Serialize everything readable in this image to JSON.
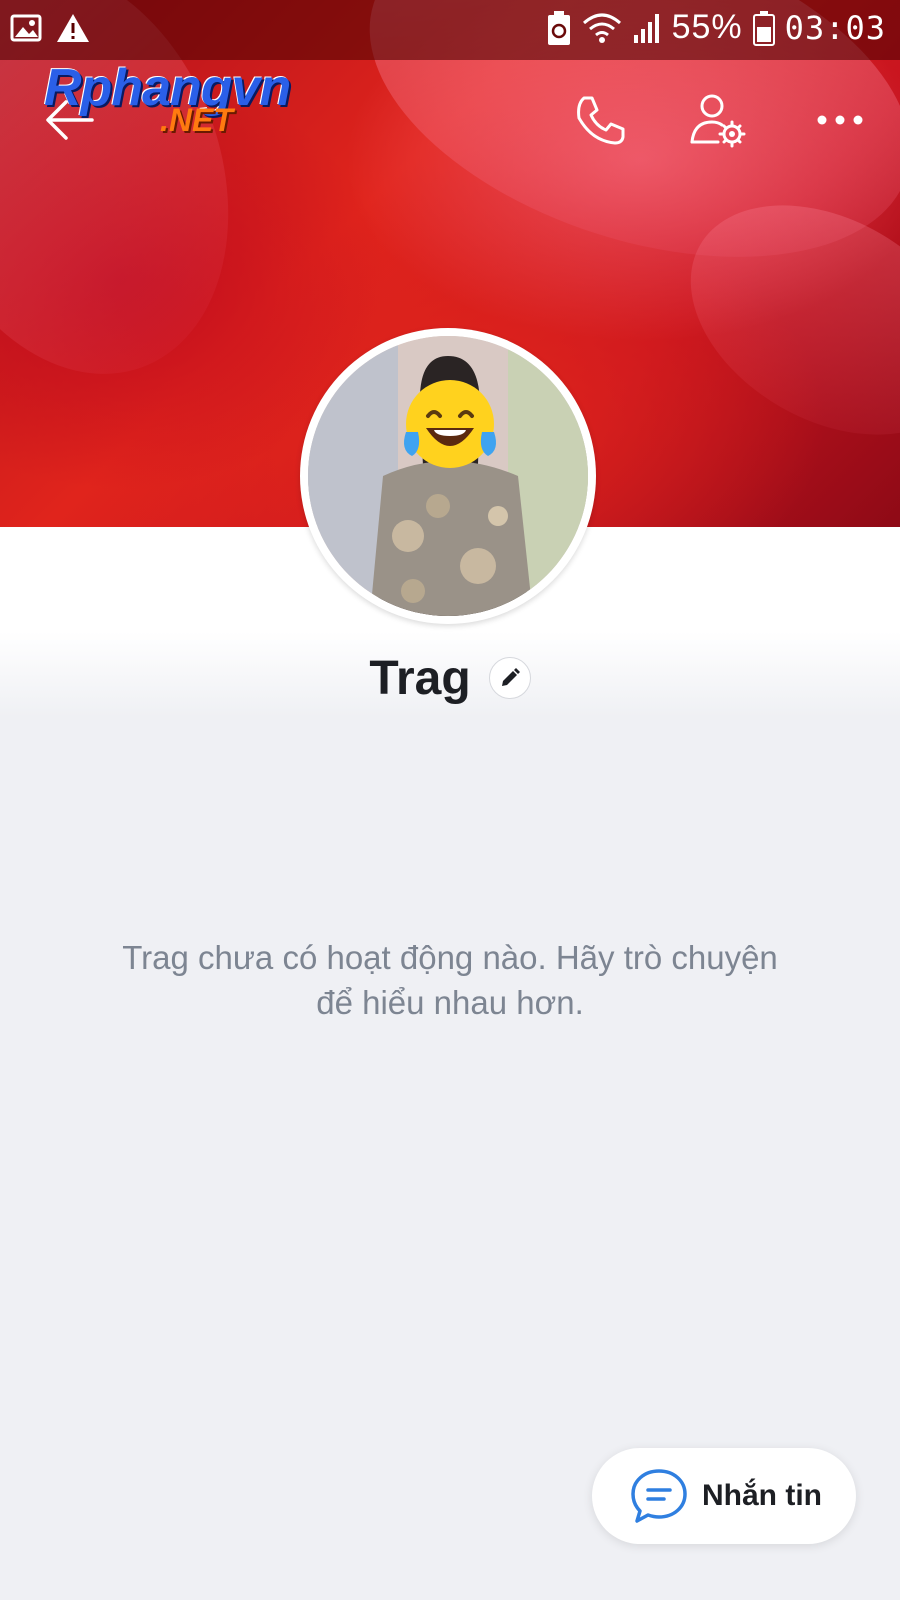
{
  "status_bar": {
    "battery_percent": "55%",
    "time": "03:03",
    "icons": [
      "image-icon",
      "warning-icon",
      "battery-saver-icon",
      "wifi-icon",
      "signal-icon",
      "battery-icon"
    ]
  },
  "watermark": {
    "line1": "Rphangvn",
    "line2": ".NET"
  },
  "header": {
    "back_icon": "back-arrow-icon",
    "actions": [
      "phone-icon",
      "user-settings-icon",
      "more-icon"
    ]
  },
  "profile": {
    "name": "Trag",
    "edit_icon": "pencil-icon"
  },
  "empty_state": {
    "message": "Trag chưa có hoạt động nào. Hãy trò chuyện để hiểu nhau hơn."
  },
  "fab": {
    "label": "Nhắn tin",
    "icon": "chat-bubble-icon"
  },
  "colors": {
    "accent": "#2f7fe0",
    "background": "#eff0f4",
    "text_primary": "#1d1f24",
    "text_secondary": "#7d8592"
  }
}
